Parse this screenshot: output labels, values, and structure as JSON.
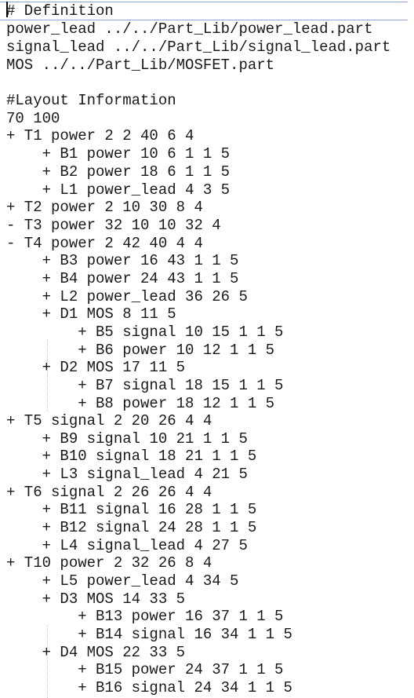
{
  "editor": {
    "lines": [
      "# Definition",
      "power_lead ../../Part_Lib/power_lead.part",
      "signal_lead ../../Part_Lib/signal_lead.part",
      "MOS ../../Part_Lib/MOSFET.part",
      "",
      "#Layout Information",
      "70 100",
      "+ T1 power 2 2 40 6 4",
      "    + B1 power 10 6 1 1 5",
      "    + B2 power 18 6 1 1 5",
      "    + L1 power_lead 4 3 5",
      "+ T2 power 2 10 30 8 4",
      "- T3 power 32 10 10 32 4",
      "- T4 power 2 42 40 4 4",
      "    + B3 power 16 43 1 1 5",
      "    + B4 power 24 43 1 1 5",
      "    + L2 power_lead 36 26 5",
      "    + D1 MOS 8 11 5",
      "        + B5 signal 10 15 1 1 5",
      "        + B6 power 10 12 1 1 5",
      "    + D2 MOS 17 11 5",
      "        + B7 signal 18 15 1 1 5",
      "        + B8 power 18 12 1 1 5",
      "+ T5 signal 2 20 26 4 4",
      "    + B9 signal 10 21 1 1 5",
      "    + B10 signal 18 21 1 1 5",
      "    + L3 signal_lead 4 21 5",
      "+ T6 signal 2 26 26 4 4",
      "    + B11 signal 16 28 1 1 5",
      "    + B12 signal 24 28 1 1 5",
      "    + L4 signal_lead 4 27 5",
      "+ T10 power 2 32 26 8 4",
      "    + L5 power_lead 4 34 5",
      "    + D3 MOS 14 33 5",
      "        + B13 power 16 37 1 1 5",
      "        + B14 signal 16 34 1 1 5",
      "    + D4 MOS 22 33 5",
      "        + B15 power 24 37 1 1 5",
      "        + B16 signal 24 34 1 1 5"
    ]
  }
}
